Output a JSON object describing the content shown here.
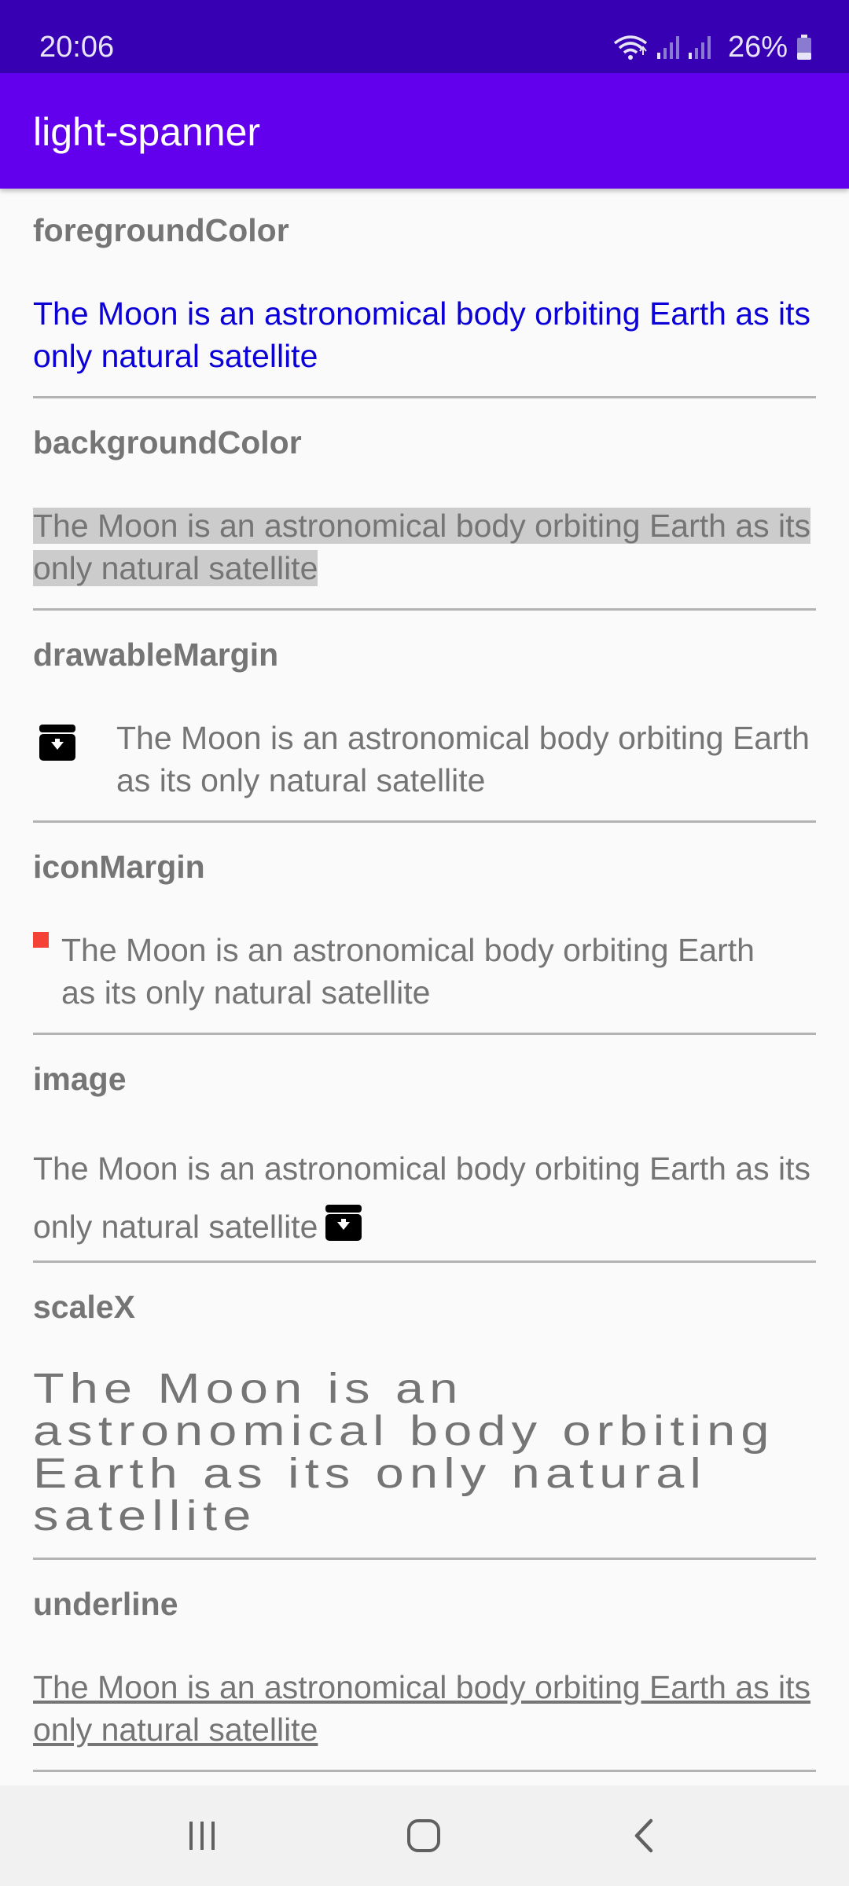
{
  "status_bar": {
    "time": "20:06",
    "battery_percent": "26%",
    "icons": [
      "wifi-icon",
      "signal-icon",
      "signal-icon",
      "battery-icon"
    ]
  },
  "app_bar": {
    "title": "light-spanner"
  },
  "sample_text": "The Moon is an astronomical body orbiting Earth as its only natural satellite",
  "sections": [
    {
      "title": "foregroundColor",
      "text": "The Moon is an astronomical body orbiting Earth as its only natural satellite",
      "color": "#0b00d6"
    },
    {
      "title": "backgroundColor",
      "text": "The Moon is an astronomical body orbiting Earth as its only natural satellite",
      "highlight": "#cccccc"
    },
    {
      "title": "drawableMargin",
      "text": "The Moon is an astronomical body orbiting Earth as its only natural satellite",
      "icon": "archive-download-icon"
    },
    {
      "title": "iconMargin",
      "text": "The Moon is an astronomical body orbiting Earth as its only natural satellite",
      "icon": "red-square-icon",
      "icon_color": "#f44336"
    },
    {
      "title": "image",
      "text": "The Moon is an astronomical body orbiting Earth as its only natural satellite",
      "icon": "archive-download-icon"
    },
    {
      "title": "scaleX",
      "text": "The Moon is an astronomical body orbiting Earth as its only natural satellite"
    },
    {
      "title": "underline",
      "text": "The Moon is an astronomical body orbiting Earth as its only natural satellite"
    }
  ],
  "nav_bar": {
    "buttons": [
      "recent-apps-icon",
      "home-icon",
      "back-icon"
    ]
  },
  "colors": {
    "status_bar": "#3700b3",
    "app_bar": "#6200ee",
    "text_gray": "#757575",
    "divider": "#b3b3b3"
  }
}
